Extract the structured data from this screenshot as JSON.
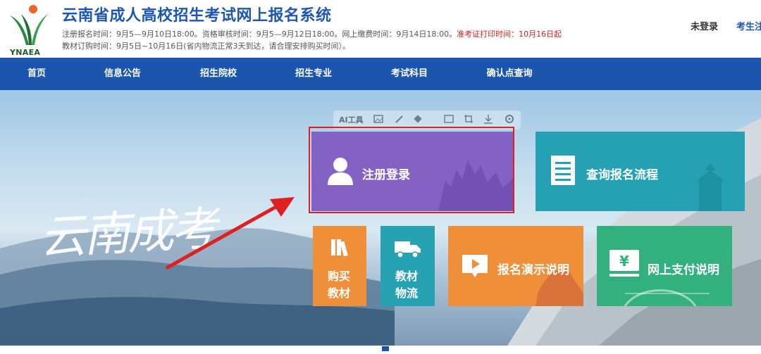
{
  "header": {
    "logo_text": "YNAEA",
    "title": "云南省成人高校招生考试网上报名系统",
    "notice_line1": "注册报名时间：9月5—9月10日18:00。资格审核时间：9月5—9月12日18:00。网上缴费时间：9月14日18:00。",
    "notice_line1_red": "准考证打印时间：10月16日起",
    "notice_line2": "教材订购时间：9月5日~10月16日(省内物流正常3天到达，请合理安排购买时间）。",
    "login_status": "未登录",
    "login_link": "考生注"
  },
  "nav": {
    "items": [
      "首页",
      "信息公告",
      "招生院校",
      "招生专业",
      "考试科目",
      "确认点查询"
    ]
  },
  "banner": {
    "calligraphy": "云南成考",
    "toolbar_label": "AI工具"
  },
  "cards": {
    "register": "注册登录",
    "process": "查询报名流程",
    "buy_books": [
      "购买",
      "教材"
    ],
    "logistics": [
      "教材",
      "物流"
    ],
    "demo": "报名演示说明",
    "payment": "网上支付说明"
  },
  "colors": {
    "brand_blue": "#1b55ad",
    "register_purple": "#8462c4",
    "process_teal": "#25a1b3",
    "orange": "#ef8f3a",
    "logistics_teal": "#27a2b2",
    "payment_green": "#32b07e",
    "highlight_red": "#e02020"
  }
}
